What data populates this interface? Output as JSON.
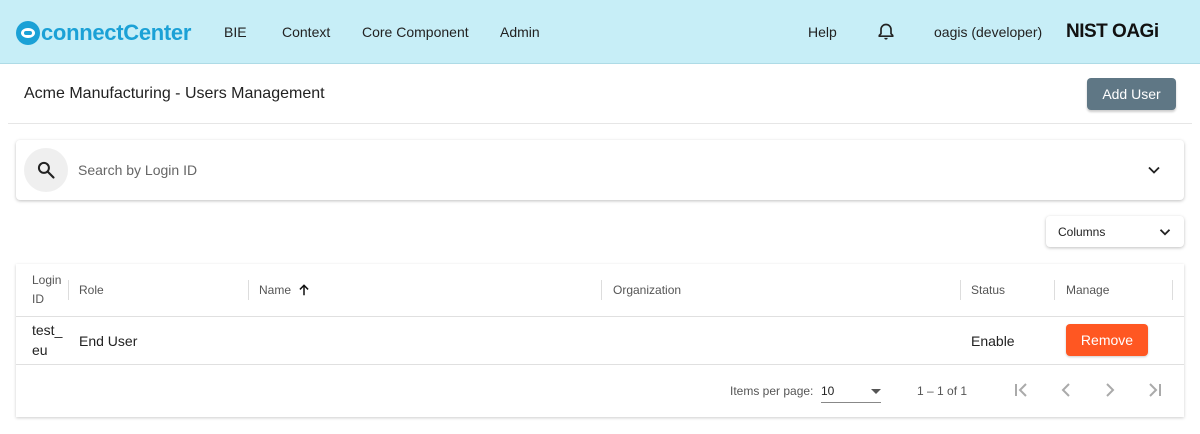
{
  "app": {
    "logo_text": "connectCenter",
    "nav": [
      "BIE",
      "Context",
      "Core Component",
      "Admin"
    ],
    "help_label": "Help",
    "user_label": "oagis (developer)",
    "brand_text": "NIST OAGi"
  },
  "page": {
    "title": "Acme Manufacturing - Users Management",
    "add_user_label": "Add User"
  },
  "search": {
    "placeholder": "Search by Login ID",
    "value": ""
  },
  "columns_dropdown": {
    "label": "Columns"
  },
  "table": {
    "headers": {
      "login_id": "Login ID",
      "role": "Role",
      "name": "Name",
      "organization": "Organization",
      "status": "Status",
      "manage": "Manage"
    },
    "sort": {
      "column": "Name",
      "direction": "asc"
    },
    "rows": [
      {
        "login_id": "test_eu",
        "role": "End User",
        "name": "",
        "organization": "",
        "status": "Enable",
        "action_label": "Remove"
      }
    ]
  },
  "paginator": {
    "items_per_page_label": "Items per page:",
    "items_per_page_value": "10",
    "range_label": "1 – 1 of 1"
  },
  "colors": {
    "topbar": "#c7eef7",
    "brand": "#1ba1d6",
    "add_user_button": "#5f7785",
    "remove_button": "#ff5722"
  },
  "icons": [
    "bell-icon",
    "search-icon",
    "chevron-down-icon",
    "arrow-up-icon",
    "first-page-icon",
    "previous-page-icon",
    "next-page-icon",
    "last-page-icon"
  ]
}
